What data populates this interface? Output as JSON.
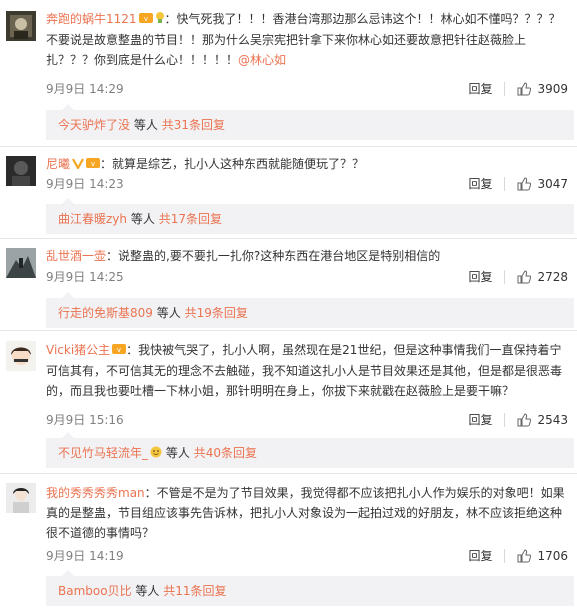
{
  "comments": [
    {
      "username": "奔跑的蜗牛1121",
      "text": "：快气死我了！！！香港台湾那边那么忌讳这个！！林心如不懂吗？？？？不要说是故意整蛊的节目！！那为什么吴宗宪把针拿下来你林心如还要故意把针往赵薇脸上扎？？？你到底是什么心！！！！！",
      "mention": "@林心如",
      "time": "9月9日 14:29",
      "reply_label": "回复",
      "likes": "3909",
      "sub": {
        "user": "今天驴炸了没",
        "mid": "等人",
        "count": "共31条回复"
      }
    },
    {
      "username": "尼曦",
      "text": "：就算是综艺，扎小人这种东西就能随便玩了？？",
      "mention": "",
      "time": "9月9日 14:23",
      "reply_label": "回复",
      "likes": "3047",
      "sub": {
        "user": "曲江春暖zyh",
        "mid": "等人",
        "count": "共17条回复"
      }
    },
    {
      "username": "乱世酒一壶",
      "text": "：说整蛊的,要不要扎一扎你?这种东西在港台地区是特别相信的",
      "mention": "",
      "time": "9月9日 14:25",
      "reply_label": "回复",
      "likes": "2728",
      "sub": {
        "user": "行走的免斯基809",
        "mid": "等人",
        "count": "共19条回复"
      }
    },
    {
      "username": "Vicki猪公主",
      "text": "：我快被气哭了，扎小人啊，虽然现在是21世纪，但是这种事情我们一直保持着宁可信其有，不可信其无的理念不去触碰，我不知道这扎小人是节目效果还是其他，但是都是很恶毒的，而且我也要吐槽一下林小姐，那针明明在身上，你拔下来就戳在赵薇脸上是要干嘛？",
      "mention": "",
      "time": "9月9日 15:16",
      "reply_label": "回复",
      "likes": "2543",
      "sub": {
        "user": "不见竹马轻流年_",
        "mid": "等人",
        "count": "共40条回复"
      }
    },
    {
      "username": "我的秀秀秀秀man",
      "text": "：不管是不是为了节目效果，我觉得都不应该把扎小人作为娱乐的对象吧！如果真的是整蛊，节目组应该事先告诉林，把扎小人对象设为一起拍过戏的好朋友，林不应该拒绝这种很不道德的事情吗？",
      "mention": "",
      "time": "9月9日 14:19",
      "reply_label": "回复",
      "likes": "1706",
      "sub": {
        "user": "Bamboo贝比",
        "mid": "等人",
        "count": "共11条回复"
      }
    }
  ],
  "icons": {
    "thumb": "thumbs-up-icon",
    "vip": "vip-badge-icon",
    "verified": "verified-v-icon"
  },
  "colors": {
    "link": "#eb7350",
    "meta": "#808080",
    "reply_bg": "#f2f2f5"
  }
}
